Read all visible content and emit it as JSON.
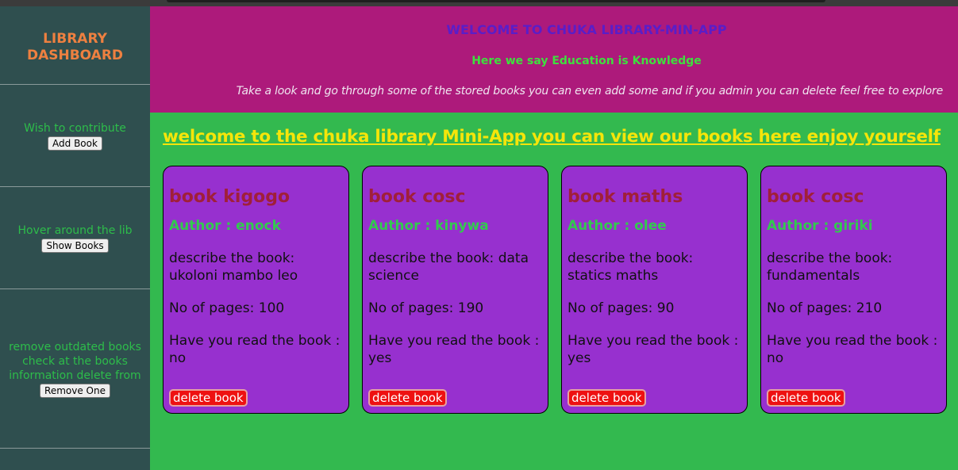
{
  "sidebar": {
    "title": "LIBRARY DASHBOARD",
    "sections": [
      {
        "text": "Wish to contribute",
        "button": "Add Book"
      },
      {
        "text": "Hover around the lib",
        "button": "Show Books"
      },
      {
        "text": "remove outdated books check at the books information delete from",
        "button": "Remove One"
      }
    ]
  },
  "header": {
    "title": "WELCOME TO CHUKA LIBRARY-MIN-APP",
    "subtitle": "Here we say Education is Knowledge",
    "description": "Take a look and go through some of the stored books you can even add some and if you admin you can delete feel free to explore"
  },
  "main": {
    "welcome": "welcome to the chuka library Mini-App you can view our books here enjoy yourself"
  },
  "books": [
    {
      "title": "book kigogo",
      "author": "Author : enock",
      "describe": "describe the book: ukoloni mambo leo",
      "pages": "No of pages: 100",
      "read": "Have you read the book : no",
      "delete": "delete book"
    },
    {
      "title": "book cosc",
      "author": "Author : kinywa",
      "describe": "describe the book: data science",
      "pages": "No of pages: 190",
      "read": "Have you read the book : yes",
      "delete": "delete book"
    },
    {
      "title": "book maths",
      "author": "Author : olee",
      "describe": "describe the book: statics maths",
      "pages": "No of pages: 90",
      "read": "Have you read the book : yes",
      "delete": "delete book"
    },
    {
      "title": "book cosc",
      "author": "Author : giriki",
      "describe": "describe the book: fundamentals",
      "pages": "No of pages: 210",
      "read": "Have you read the book : no",
      "delete": "delete book"
    }
  ],
  "colors": {
    "sidebar": "#2f4f4f",
    "header": "#ad1a7b",
    "main": "#33b94f",
    "card": "#9730cf",
    "delete_button": "#ee1111"
  }
}
